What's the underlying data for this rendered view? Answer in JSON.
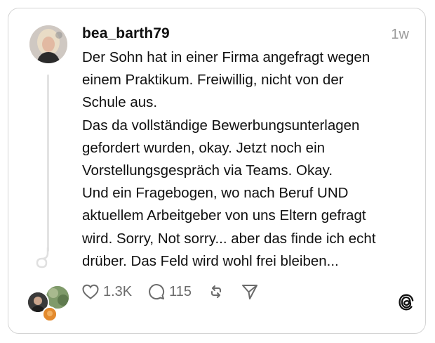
{
  "post": {
    "username": "bea_barth79",
    "time": "1w",
    "lines": [
      "Der Sohn hat in einer Firma angefragt wegen",
      "einem Praktikum. Freiwillig, nicht von der",
      "Schule aus.",
      "Das da vollständige Bewerbungsunterlagen",
      "gefordert wurden, okay. Jetzt noch ein",
      "Vorstellungsgespräch via Teams. Okay.",
      "Und ein Fragebogen, wo nach Beruf UND",
      "aktuellem Arbeitgeber von uns Eltern gefragt",
      "wird. Sorry, Not sorry... aber das finde ich echt",
      "drüber. Das Feld wird wohl frei bleiben..."
    ]
  },
  "actions": {
    "likes": "1.3K",
    "replies": "115"
  },
  "icons": {
    "like": "heart-icon",
    "reply": "comment-icon",
    "repost": "repost-icon",
    "share": "send-icon",
    "brand": "threads-logo-icon"
  }
}
